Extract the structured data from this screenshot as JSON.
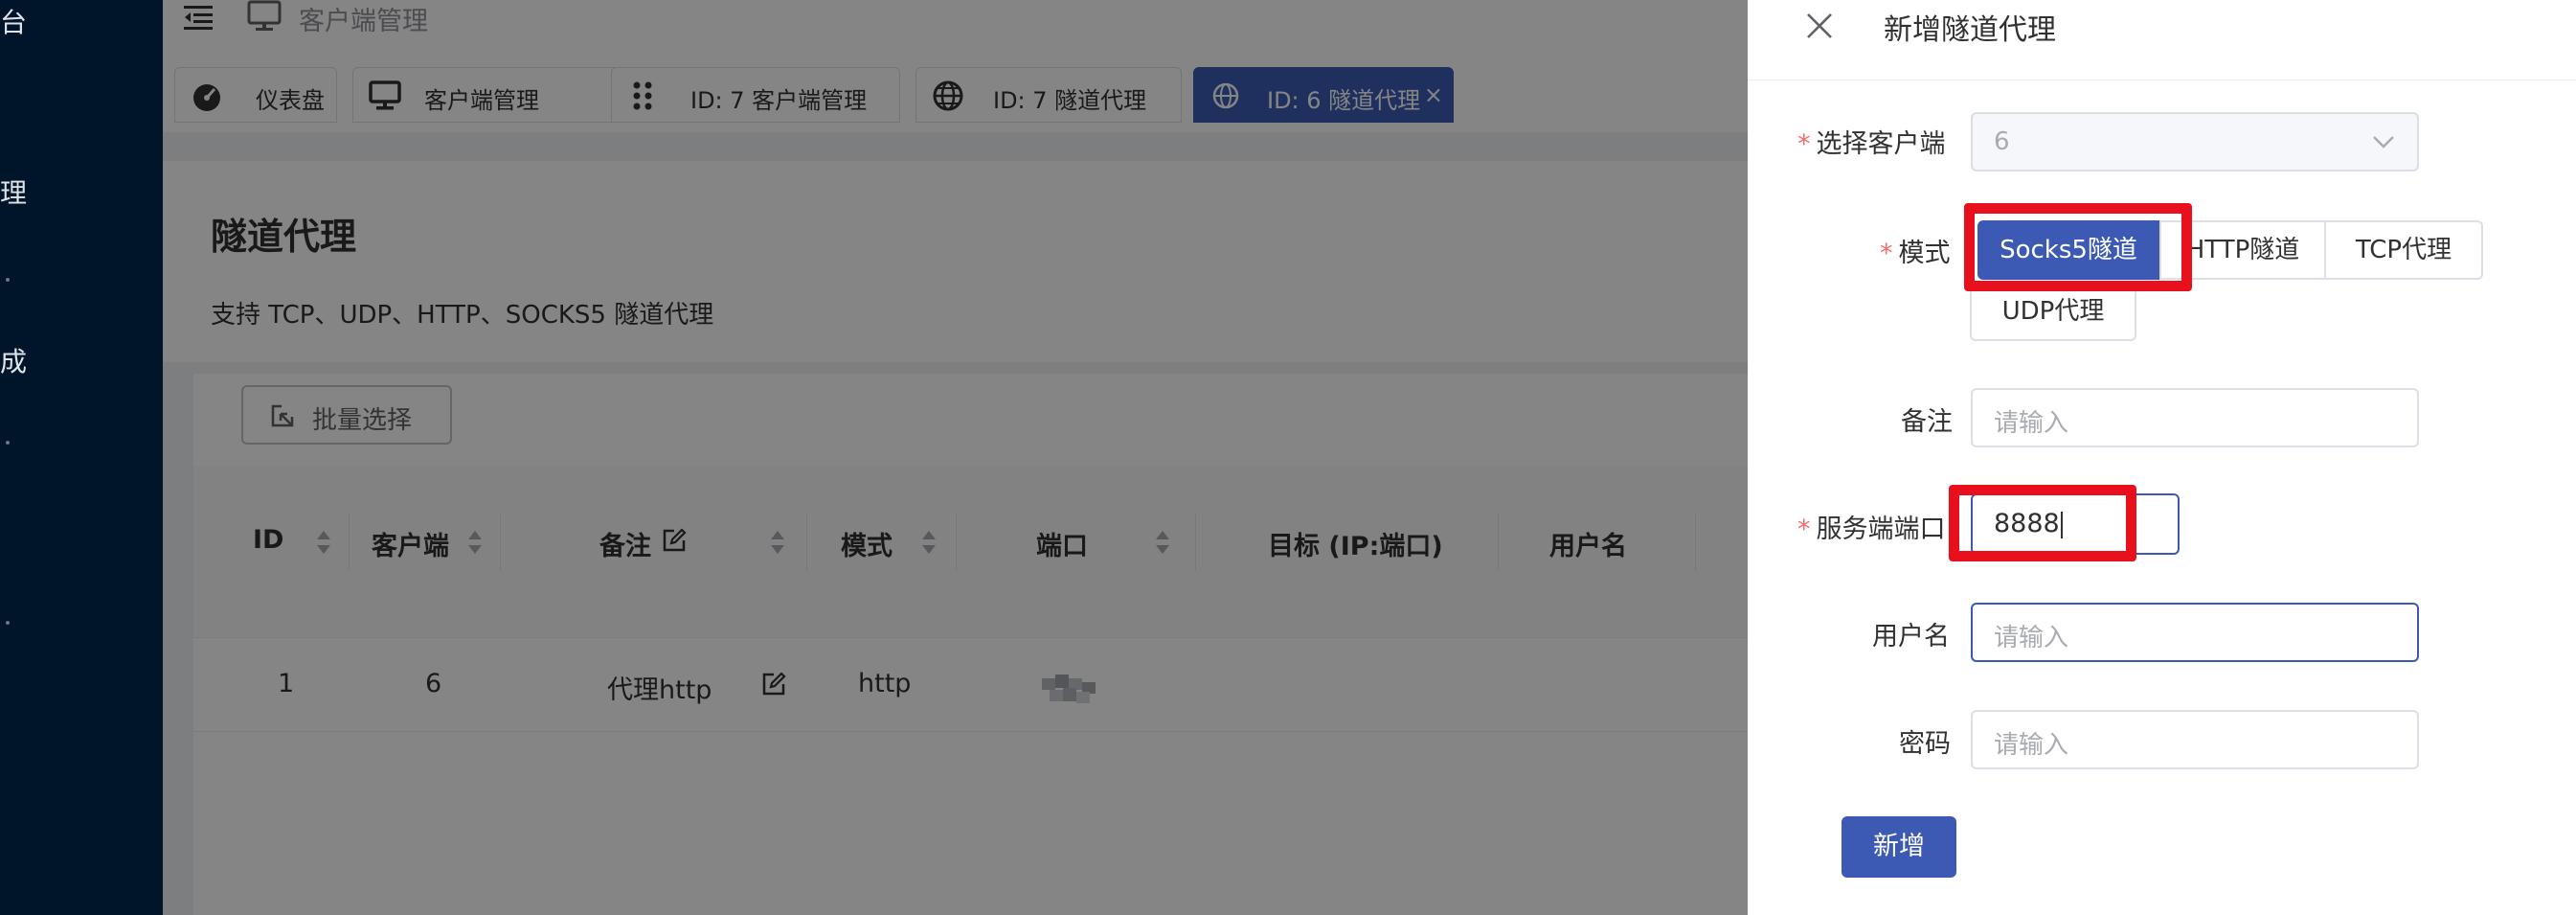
{
  "sidebar": {
    "fragments": [
      "台",
      "管理",
      "成"
    ]
  },
  "topbar": {
    "breadcrumb": "客户端管理"
  },
  "tabs": [
    {
      "label": "仪表盘",
      "icon": "dashboard-icon"
    },
    {
      "label": "客户端管理",
      "icon": "monitor-icon"
    },
    {
      "label": "ID: 7 客户端管理",
      "icon": "drag-dots-icon"
    },
    {
      "label": "ID: 7 隧道代理",
      "icon": "globe-icon"
    },
    {
      "label": "ID: 6 隧道代理",
      "icon": "globe-icon",
      "active": true,
      "close": "×"
    }
  ],
  "page": {
    "title": "隧道代理",
    "description": "支持 TCP、UDP、HTTP、SOCKS5 隧道代理"
  },
  "toolbar": {
    "batch_select_label": "批量选择"
  },
  "table": {
    "columns": [
      "ID",
      "客户端",
      "备注",
      "模式",
      "端口",
      "目标 (IP:端口)",
      "用户名"
    ],
    "rows": [
      {
        "id": "1",
        "client": "6",
        "remark": "代理http",
        "mode": "http"
      }
    ]
  },
  "drawer": {
    "title": "新增隧道代理",
    "client_label": "选择客户端",
    "client_value": "6",
    "mode_label": "模式",
    "modes": [
      "Socks5隧道",
      "HTTP隧道",
      "TCP代理",
      "UDP代理"
    ],
    "selected_mode": "Socks5隧道",
    "remark_label": "备注",
    "remark_placeholder": "请输入",
    "port_label": "服务端端口",
    "port_value": "8888",
    "username_label": "用户名",
    "username_placeholder": "请输入",
    "password_label": "密码",
    "password_placeholder": "请输入",
    "submit_label": "新增",
    "required_mark": "*"
  },
  "colors": {
    "primary": "#3c5ab4",
    "sidebar_bg": "#001529",
    "highlight": "#e8101d",
    "required": "#f56c6c"
  }
}
